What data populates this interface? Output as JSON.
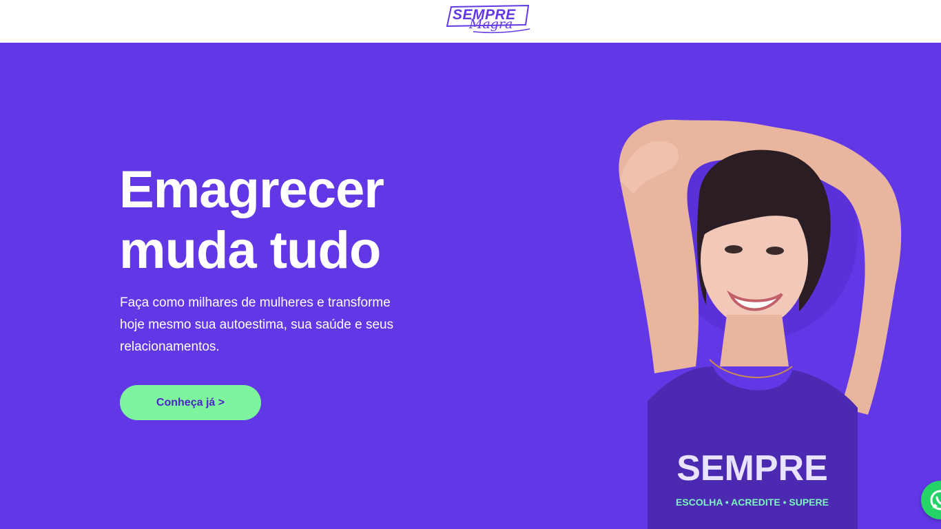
{
  "header": {
    "logo_line1": "SEMPRE",
    "logo_line2": "Magra"
  },
  "hero": {
    "headline_line1": "Emagrecer",
    "headline_line2": "muda tudo",
    "subtitle": "Faça como milhares de mulheres e transforme hoje mesmo sua autoestima, sua saúde e seus relacionamentos.",
    "cta_label": "Conheça já >",
    "shirt_brand": "SEMPRE",
    "shirt_tagline": "ESCOLHA • ACREDITE • SUPERE"
  },
  "icons": {
    "whatsapp": "whatsapp-icon"
  },
  "colors": {
    "brand_purple": "#6237e6",
    "cta_green": "#7ef49e",
    "whatsapp_green": "#25d366",
    "white": "#ffffff"
  }
}
